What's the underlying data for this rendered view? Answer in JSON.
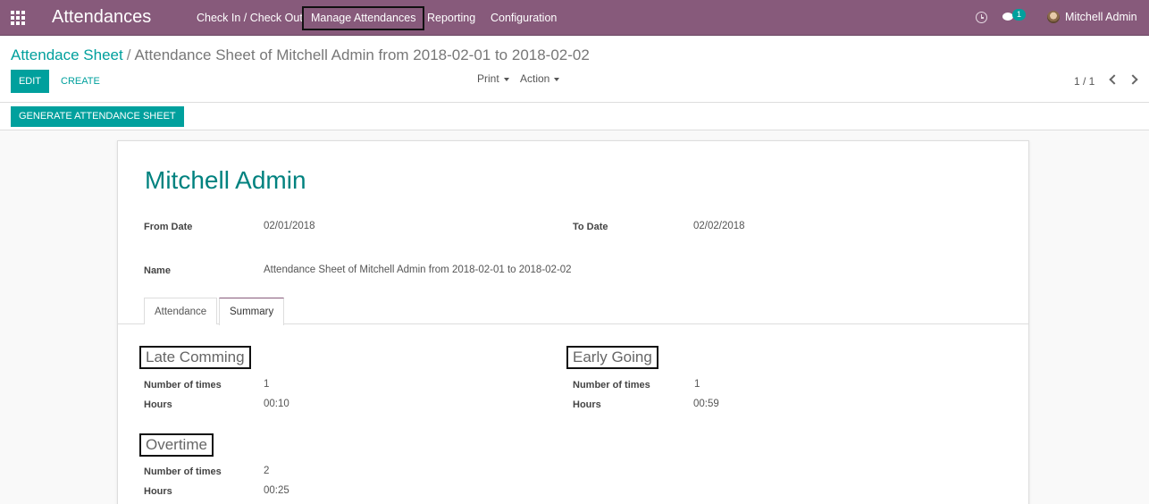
{
  "navbar": {
    "app_title": "Attendances",
    "menu": [
      "Check In / Check Out",
      "Manage Attendances",
      "Reporting",
      "Configuration"
    ],
    "chat_badge": "1",
    "user_name": "Mitchell Admin",
    "color": "#875a7b"
  },
  "breadcrumb": {
    "parent": "Attendace Sheet",
    "separator": "/",
    "current": "Attendance Sheet of Mitchell Admin from 2018-02-01 to 2018-02-02"
  },
  "toolbar": {
    "edit_label": "EDIT",
    "create_label": "CREATE",
    "print_label": "Print",
    "action_label": "Action",
    "pager": "1 / 1"
  },
  "header": {
    "generate_label": "GENERATE ATTENDANCE SHEET"
  },
  "form": {
    "employee_name": "Mitchell Admin",
    "from_date_label": "From Date",
    "from_date_value": "02/01/2018",
    "to_date_label": "To Date",
    "to_date_value": "02/02/2018",
    "name_label": "Name",
    "name_value": "Attendance Sheet of Mitchell Admin from 2018-02-01 to 2018-02-02"
  },
  "tabs": [
    "Attendance",
    "Summary"
  ],
  "summary": {
    "late": {
      "title": "Late Comming",
      "times_label": "Number of times",
      "times_value": "1",
      "hours_label": "Hours",
      "hours_value": "00:10"
    },
    "early": {
      "title": "Early Going",
      "times_label": "Number of times",
      "times_value": "1",
      "hours_label": "Hours",
      "hours_value": "00:59"
    },
    "overtime": {
      "title": "Overtime",
      "times_label": "Number of times",
      "times_value": "2",
      "hours_label": "Hours",
      "hours_value": "00:25"
    }
  },
  "colors": {
    "primary": "#00a09d",
    "navbar": "#875a7b"
  }
}
